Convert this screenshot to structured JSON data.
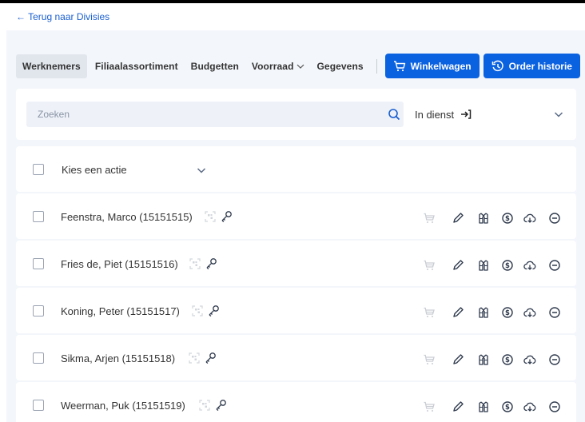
{
  "nav": {
    "back_link": "← Terug naar Divisies",
    "tabs": [
      {
        "label": "Werknemers",
        "active": true
      },
      {
        "label": "Filiaalassortiment",
        "active": false
      },
      {
        "label": "Budgetten",
        "active": false
      },
      {
        "label": "Voorraad",
        "active": false,
        "has_dropdown": true
      },
      {
        "label": "Gegevens",
        "active": false
      }
    ],
    "cart_button": "Winkelwagen",
    "history_button": "Order historie"
  },
  "search": {
    "placeholder": "Zoeken",
    "status_value": "In dienst"
  },
  "action_select": {
    "label": "Kies een actie"
  },
  "employees": [
    {
      "name": "Feenstra, Marco (15151515)"
    },
    {
      "name": "Fries de, Piet (15151516)"
    },
    {
      "name": "Koning, Peter (15151517)"
    },
    {
      "name": "Sikma, Arjen (15151518)"
    },
    {
      "name": "Weerman, Puk (15151519)"
    }
  ],
  "row_action_icons": [
    "cart-icon",
    "pencil-icon",
    "clothing-icon",
    "budget-icon",
    "download-icon",
    "remove-icon"
  ],
  "colors": {
    "accent": "#0b62e0",
    "link": "#1a5fd0",
    "background": "#f3f6fa"
  }
}
